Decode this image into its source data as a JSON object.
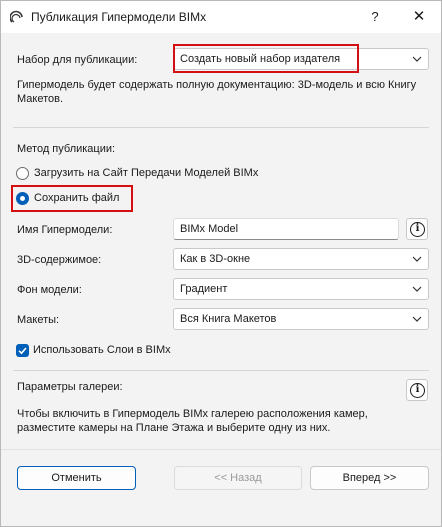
{
  "window": {
    "title": "Публикация Гипермодели BIMx",
    "help_label": "?",
    "close_label": "✕",
    "icon": "archicad-app-icon"
  },
  "publish_set": {
    "label": "Набор для публикации:",
    "value": "Создать новый набор издателя",
    "description": "Гипермодель будет содержать полную документацию: 3D-модель и всю Книгу Макетов."
  },
  "method": {
    "label": "Метод публикации:",
    "options": [
      {
        "label": "Загрузить на Сайт Передачи Моделей BIMx",
        "selected": false
      },
      {
        "label": "Сохранить файл",
        "selected": true
      }
    ]
  },
  "fields": {
    "name_label": "Имя Гипермодели:",
    "name_value": "BIMx Model",
    "content_label": "3D-содержимое:",
    "content_value": "Как в 3D-окне",
    "background_label": "Фон модели:",
    "background_value": "Градиент",
    "layouts_label": "Макеты:",
    "layouts_value": "Вся Книга Макетов",
    "use_layers_label": "Использовать Слои в BIMx",
    "use_layers_checked": true
  },
  "gallery": {
    "label": "Параметры галереи:",
    "text": "Чтобы включить в Гипермодель BIMx галерею расположения камер, разместите камеры на Плане Этажа и выберите одну из них."
  },
  "buttons": {
    "cancel": "Отменить",
    "back": "<< Назад",
    "next": "Вперед >>"
  },
  "colors": {
    "accent": "#005fb8",
    "highlight": "#d40f14"
  }
}
